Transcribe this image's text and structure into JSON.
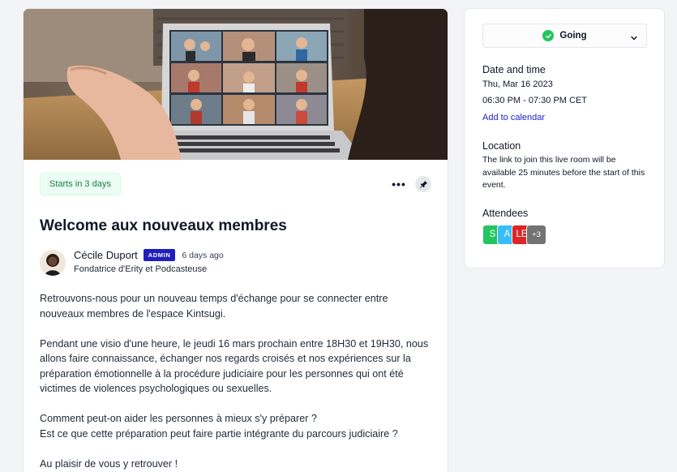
{
  "event": {
    "starts_badge": "Starts in 3 days",
    "more_label": "•••",
    "title": "Welcome aux nouveaux membres",
    "author": {
      "name": "Cécile Duport",
      "role_badge": "ADMIN",
      "time": "6 days ago",
      "headline": "Fondatrice d'Erity et Podcasteuse"
    },
    "body": [
      "Retrouvons-nous pour un nouveau temps d'échange pour se connecter entre nouveaux membres de l'espace Kintsugi.",
      "Pendant une visio d'une heure, le jeudi 16 mars prochain entre 18H30 et 19H30, nous allons faire connaissance, échanger nos regards croisés et nos expériences sur la préparation émotionnelle à la procédure judiciaire pour les personnes qui ont été victimes de violences psychologiques ou sexuelles.",
      "Comment peut-on aider les personnes à mieux s'y préparer ?\nEst ce que cette préparation peut faire partie intégrante du parcours judiciaire ?",
      "Au plaisir de vous y retrouver !"
    ]
  },
  "sidebar": {
    "rsvp": {
      "label": "Going",
      "color": "#22c55e"
    },
    "date_time": {
      "title": "Date and time",
      "date": "Thu, Mar 16 2023",
      "time": "06:30 PM - 07:30 PM CET",
      "add_to_calendar": "Add to calendar"
    },
    "location": {
      "title": "Location",
      "text": "The link to join this live room will be available 25 minutes before the start of this event."
    },
    "attendees": {
      "title": "Attendees",
      "items": [
        {
          "initials": "S",
          "color": "#22c55e"
        },
        {
          "initials": "A",
          "color": "#38bdf8"
        },
        {
          "initials": "LE",
          "color": "#dc2626"
        },
        {
          "initials": "+3",
          "color": "#737373"
        }
      ]
    }
  },
  "icons": {
    "more": "more-horizontal-icon",
    "pin": "pin-icon",
    "check": "check-icon",
    "chevron": "chevron-down-icon"
  },
  "colors": {
    "accent_link": "#1e1ec8",
    "admin_badge": "#1f1fbf",
    "status_green": "#15803d"
  }
}
